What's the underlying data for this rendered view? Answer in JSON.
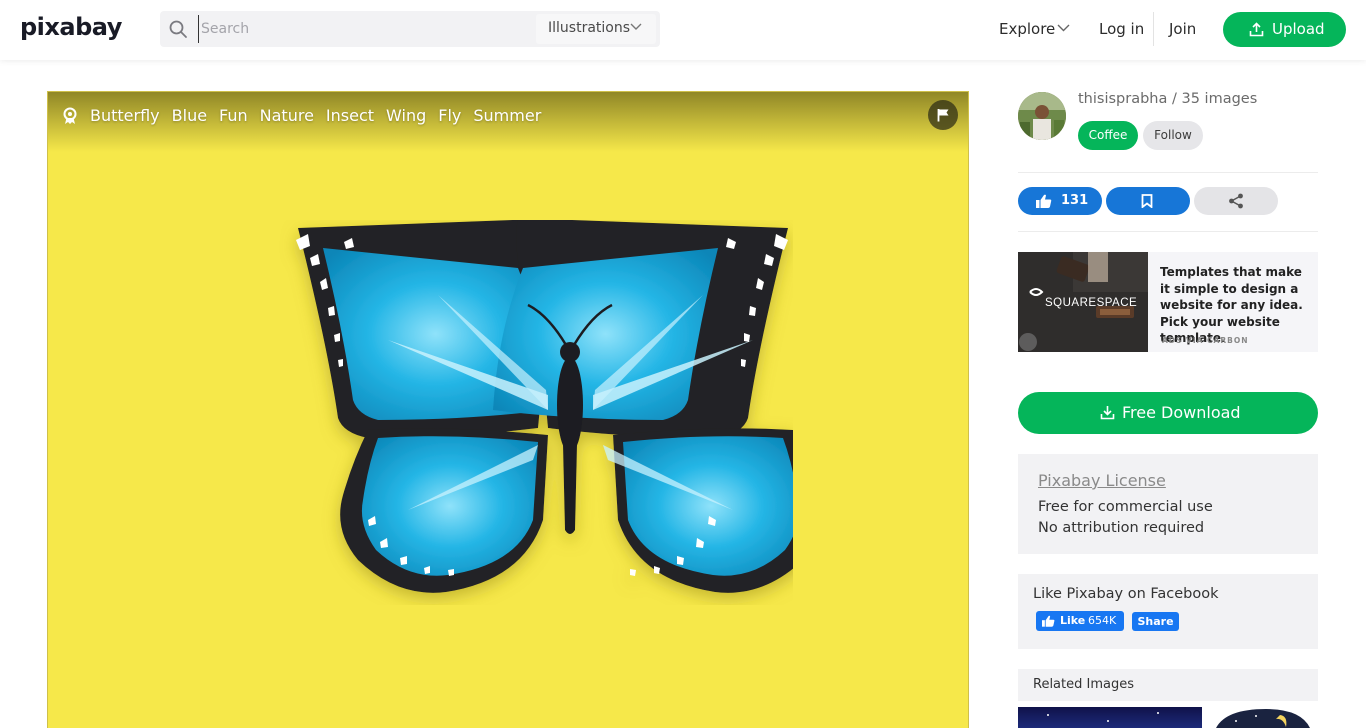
{
  "header": {
    "logo": "pixabay",
    "search_placeholder": "Search",
    "search_type": "Illustrations",
    "explore_label": "Explore",
    "login_label": "Log in",
    "join_label": "Join",
    "upload_label": "Upload"
  },
  "image": {
    "tags": [
      "Butterfly",
      "Blue",
      "Fun",
      "Nature",
      "Insect",
      "Wing",
      "Fly",
      "Summer"
    ],
    "background_color": "#f6e84a",
    "wing_color": "#25b6e6"
  },
  "author": {
    "name_line": "thisisprabha / 35 images",
    "coffee_label": "Coffee",
    "follow_label": "Follow"
  },
  "actions": {
    "like_count": "131"
  },
  "ad": {
    "text": "Templates that make it simple to design a website for any idea. Pick your website template.",
    "brand": "SQUARESPACE",
    "via": "ADS VIA CARBON"
  },
  "download": {
    "label": "Free Download"
  },
  "license": {
    "title": "Pixabay License",
    "line1": "Free for commercial use",
    "line2": "No attribution required"
  },
  "facebook": {
    "title": "Like Pixabay on Facebook",
    "like_label": "Like",
    "like_count": "654K",
    "share_label": "Share"
  },
  "related": {
    "title": "Related Images"
  },
  "colors": {
    "accent_green": "#05b55a",
    "accent_blue": "#1776d7",
    "facebook_blue": "#1877f2"
  }
}
